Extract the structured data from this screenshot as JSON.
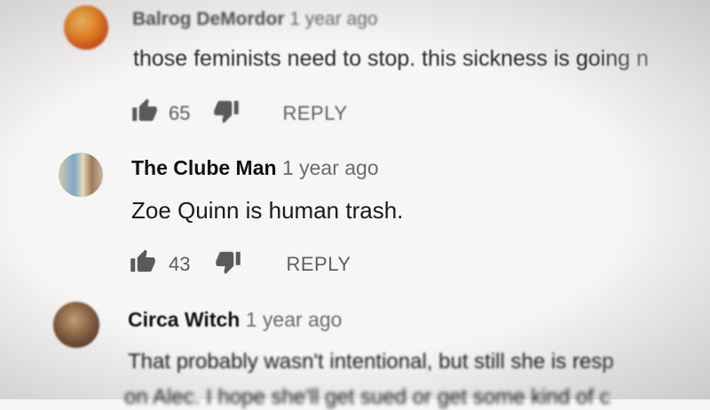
{
  "comments": [
    {
      "author": "Balrog DeMordor",
      "time": "1 year ago",
      "text": "those feminists need to stop. this sickness is going n",
      "likes": "65",
      "reply_label": "REPLY",
      "avatar_icon": "user-avatar-orange"
    },
    {
      "author": "The Clube Man",
      "time": "1 year ago",
      "text": "Zoe Quinn is human trash.",
      "likes": "43",
      "reply_label": "REPLY",
      "avatar_icon": "user-avatar-photo"
    },
    {
      "author": "Circa Witch",
      "time": "1 year ago",
      "text": "That probably wasn't intentional, but still she is resp",
      "text_line2": "on Alec. I hope she'll get sued or get some kind of c",
      "avatar_icon": "user-avatar-brown"
    }
  ],
  "icons": {
    "like": "thumb-up-icon",
    "dislike": "thumb-down-icon"
  },
  "colors": {
    "background": "#f6f6f6",
    "author": "#111111",
    "meta": "#6b6b6b",
    "action": "#5a5a5a"
  }
}
